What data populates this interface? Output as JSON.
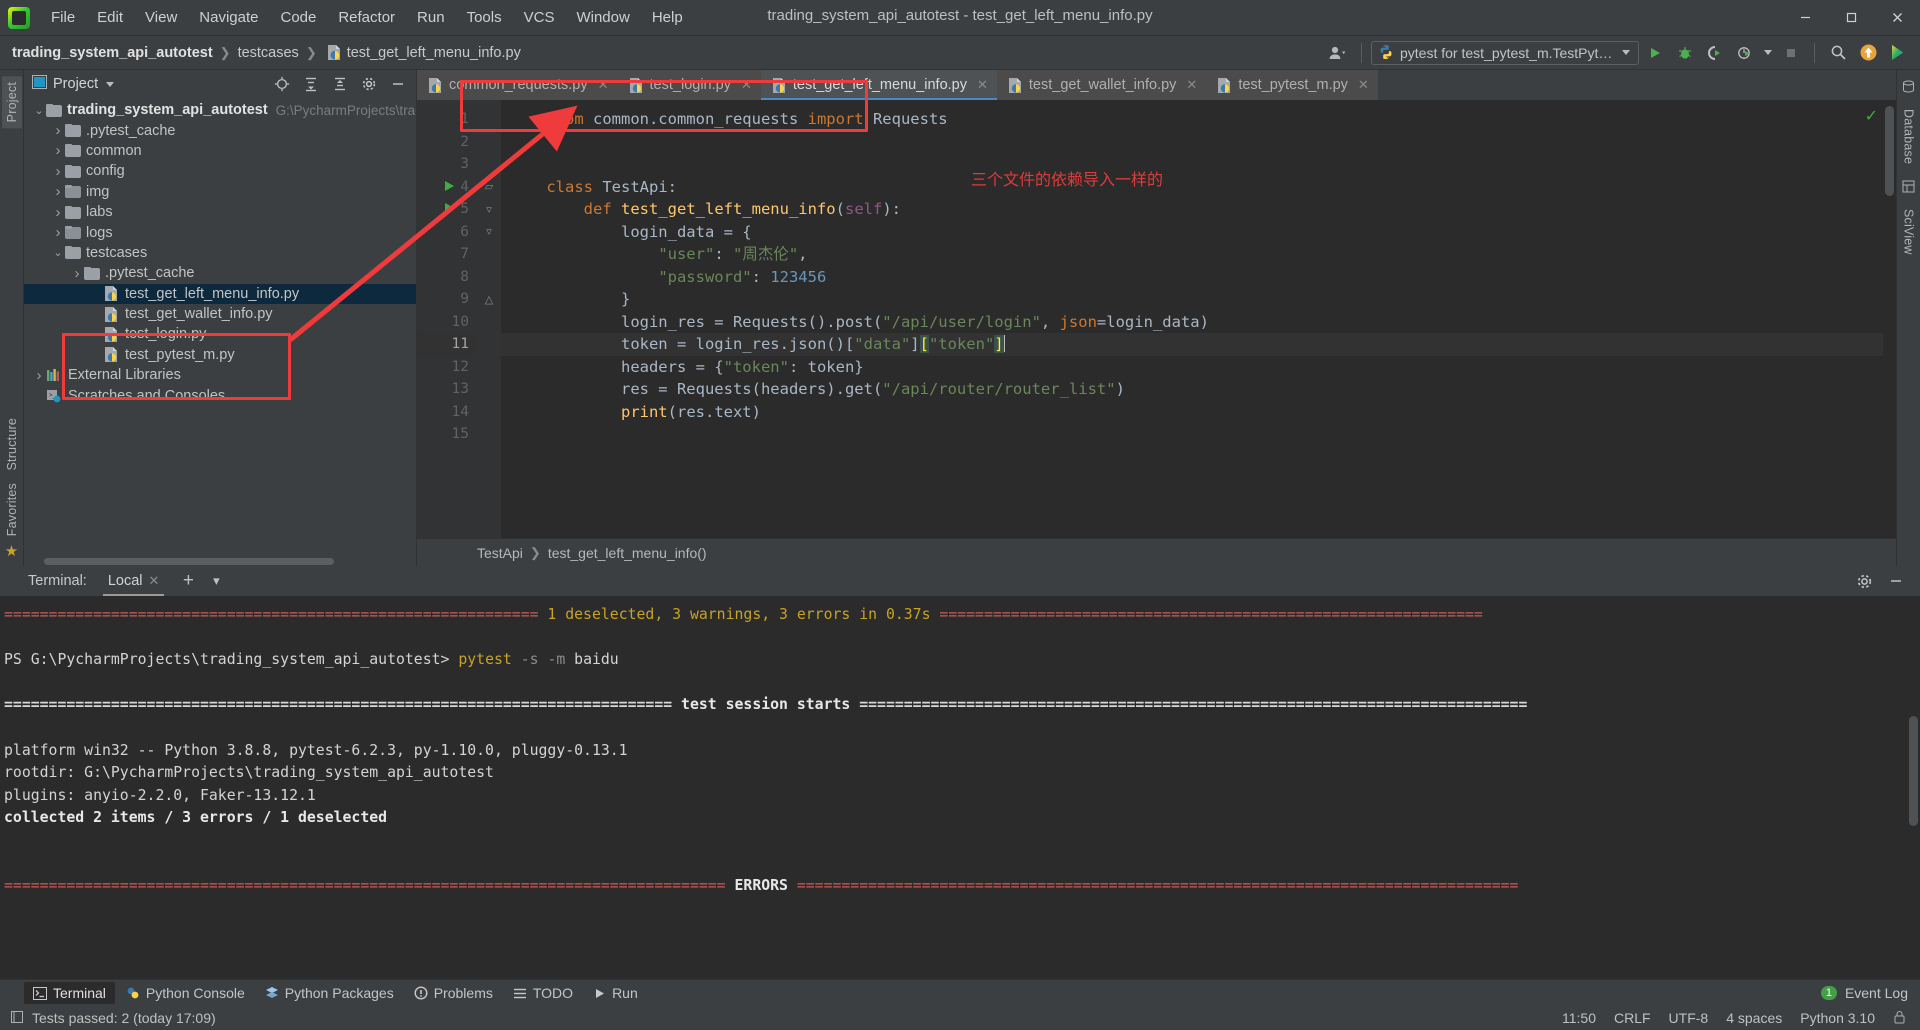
{
  "window": {
    "title": "trading_system_api_autotest - test_get_left_menu_info.py",
    "minimize": "—",
    "maximize": "▢",
    "close": "✕"
  },
  "menubar": [
    "File",
    "Edit",
    "View",
    "Navigate",
    "Code",
    "Refactor",
    "Run",
    "Tools",
    "VCS",
    "Window",
    "Help"
  ],
  "breadcrumb": {
    "project": "trading_system_api_autotest",
    "folder": "testcases",
    "file": "test_get_left_menu_info.py",
    "separator": "❯"
  },
  "toolbar": {
    "run_config": "pytest for test_pytest_m.TestPytest",
    "run_icon": "run-icon",
    "debug_icon": "debug-icon",
    "coverage_icon": "coverage-icon",
    "profile_icon": "profile-icon",
    "stop_icon": "stop-icon",
    "search_icon": "search-icon",
    "update_icon": "update-project-icon",
    "ide_icon": "ide-icon",
    "account_icon": "account-icon"
  },
  "left_strip": [
    "Project"
  ],
  "right_strip": [
    "Database",
    "SciView"
  ],
  "bottom_strip": [
    "Structure",
    "Favorites"
  ],
  "project_panel": {
    "title": "Project",
    "header_icons": [
      "target-icon",
      "expand-all-icon",
      "collapse-all-icon",
      "settings-icon",
      "hide-icon"
    ],
    "tree": [
      {
        "depth": 0,
        "arrow": "v",
        "icon": "folder",
        "label": "trading_system_api_autotest",
        "bold": true,
        "path": "G:\\PycharmProjects\\trading_",
        "selected": false
      },
      {
        "depth": 1,
        "arrow": ">",
        "icon": "folder",
        "label": ".pytest_cache",
        "bold": false,
        "path": "",
        "selected": false
      },
      {
        "depth": 1,
        "arrow": ">",
        "icon": "folder",
        "label": "common",
        "bold": false,
        "path": "",
        "selected": false
      },
      {
        "depth": 1,
        "arrow": ">",
        "icon": "folder",
        "label": "config",
        "bold": false,
        "path": "",
        "selected": false
      },
      {
        "depth": 1,
        "arrow": ">",
        "icon": "folder-dot",
        "label": "img",
        "bold": false,
        "path": "",
        "selected": false
      },
      {
        "depth": 1,
        "arrow": ">",
        "icon": "folder",
        "label": "labs",
        "bold": false,
        "path": "",
        "selected": false
      },
      {
        "depth": 1,
        "arrow": ">",
        "icon": "folder-dot",
        "label": "logs",
        "bold": false,
        "path": "",
        "selected": false
      },
      {
        "depth": 1,
        "arrow": "v",
        "icon": "folder",
        "label": "testcases",
        "bold": false,
        "path": "",
        "selected": false
      },
      {
        "depth": 2,
        "arrow": ">",
        "icon": "folder",
        "label": ".pytest_cache",
        "bold": false,
        "path": "",
        "selected": false
      },
      {
        "depth": 3,
        "arrow": "",
        "icon": "python",
        "label": "test_get_left_menu_info.py",
        "bold": false,
        "path": "",
        "selected": true
      },
      {
        "depth": 3,
        "arrow": "",
        "icon": "python",
        "label": "test_get_wallet_info.py",
        "bold": false,
        "path": "",
        "selected": false
      },
      {
        "depth": 3,
        "arrow": "",
        "icon": "python",
        "label": "test_login.py",
        "bold": false,
        "path": "",
        "selected": false
      },
      {
        "depth": 3,
        "arrow": "",
        "icon": "python",
        "label": "test_pytest_m.py",
        "bold": false,
        "path": "",
        "selected": false
      },
      {
        "depth": 0,
        "arrow": ">",
        "icon": "library",
        "label": "External Libraries",
        "bold": false,
        "path": "",
        "selected": false
      },
      {
        "depth": 0,
        "arrow": "",
        "icon": "scratches",
        "label": "Scratches and Consoles",
        "bold": false,
        "path": "",
        "selected": false
      }
    ]
  },
  "editor": {
    "tabs": [
      {
        "label": "common_requests.py",
        "active": false,
        "closable": true
      },
      {
        "label": "test_login.py",
        "active": false,
        "closable": true
      },
      {
        "label": "test_get_left_menu_info.py",
        "active": true,
        "closable": true
      },
      {
        "label": "test_get_wallet_info.py",
        "active": false,
        "closable": true
      },
      {
        "label": "test_pytest_m.py",
        "active": false,
        "closable": true
      }
    ],
    "line_numbers": [
      "1",
      "2",
      "3",
      "4",
      "5",
      "6",
      "7",
      "8",
      "9",
      "10",
      "11",
      "12",
      "13",
      "14",
      "15"
    ],
    "current_line": 11,
    "run_markers": [
      4,
      5
    ],
    "lines": [
      {
        "n": 1,
        "tokens": [
          {
            "t": "    ",
            "c": "plain"
          },
          {
            "t": "from",
            "c": "kw"
          },
          {
            "t": " common.common_requests ",
            "c": "plain"
          },
          {
            "t": "import",
            "c": "kw"
          },
          {
            "t": " Requests",
            "c": "plain"
          }
        ]
      },
      {
        "n": 2,
        "tokens": []
      },
      {
        "n": 3,
        "tokens": []
      },
      {
        "n": 4,
        "tokens": [
          {
            "t": "    ",
            "c": "plain"
          },
          {
            "t": "class",
            "c": "kw"
          },
          {
            "t": " TestApi",
            "c": "cls"
          },
          {
            "t": ":",
            "c": "plain"
          }
        ]
      },
      {
        "n": 5,
        "tokens": [
          {
            "t": "        ",
            "c": "plain"
          },
          {
            "t": "def",
            "c": "kw"
          },
          {
            "t": " ",
            "c": "plain"
          },
          {
            "t": "test_get_left_menu_info",
            "c": "fn"
          },
          {
            "t": "(",
            "c": "plain"
          },
          {
            "t": "self",
            "c": "self"
          },
          {
            "t": "):",
            "c": "plain"
          }
        ]
      },
      {
        "n": 6,
        "tokens": [
          {
            "t": "            login_data = {",
            "c": "plain"
          }
        ]
      },
      {
        "n": 7,
        "tokens": [
          {
            "t": "                ",
            "c": "plain"
          },
          {
            "t": "\"user\"",
            "c": "str"
          },
          {
            "t": ": ",
            "c": "plain"
          },
          {
            "t": "\"周杰伦\"",
            "c": "str"
          },
          {
            "t": ",",
            "c": "plain"
          }
        ]
      },
      {
        "n": 8,
        "tokens": [
          {
            "t": "                ",
            "c": "plain"
          },
          {
            "t": "\"password\"",
            "c": "str"
          },
          {
            "t": ": ",
            "c": "plain"
          },
          {
            "t": "123456",
            "c": "num"
          }
        ]
      },
      {
        "n": 9,
        "tokens": [
          {
            "t": "            }",
            "c": "plain"
          }
        ]
      },
      {
        "n": 10,
        "tokens": [
          {
            "t": "            login_res = Requests().post(",
            "c": "plain"
          },
          {
            "t": "\"/api/user/login\"",
            "c": "str"
          },
          {
            "t": ", ",
            "c": "plain"
          },
          {
            "t": "json",
            "c": "param"
          },
          {
            "t": "=login_data)",
            "c": "plain"
          }
        ]
      },
      {
        "n": 11,
        "tokens": [
          {
            "t": "            token = login_res.json()[",
            "c": "plain"
          },
          {
            "t": "\"data\"",
            "c": "str"
          },
          {
            "t": "]",
            "c": "plain"
          },
          {
            "t": "[",
            "c": "brhl"
          },
          {
            "t": "\"token\"",
            "c": "str"
          },
          {
            "t": "]",
            "c": "brhl"
          }
        ]
      },
      {
        "n": 12,
        "tokens": [
          {
            "t": "            headers = {",
            "c": "plain"
          },
          {
            "t": "\"token\"",
            "c": "str"
          },
          {
            "t": ": token}",
            "c": "plain"
          }
        ]
      },
      {
        "n": 13,
        "tokens": [
          {
            "t": "            res = Requests(headers).get(",
            "c": "plain"
          },
          {
            "t": "\"/api/router/router_list\"",
            "c": "str"
          },
          {
            "t": ")",
            "c": "plain"
          }
        ]
      },
      {
        "n": 14,
        "tokens": [
          {
            "t": "            ",
            "c": "plain"
          },
          {
            "t": "print",
            "c": "fn"
          },
          {
            "t": "(res.text)",
            "c": "plain"
          }
        ]
      },
      {
        "n": 15,
        "tokens": []
      }
    ],
    "annotation_cn": "三个文件的依赖导入一样的",
    "breadcrumb_bottom": {
      "class": "TestApi",
      "method": "test_get_left_menu_info()",
      "separator": "❯"
    },
    "inspection_status": "✓"
  },
  "terminal": {
    "label": "Terminal:",
    "tab": "Local",
    "add_icon": "+",
    "dropdown_icon": "▾",
    "settings_icon": "gear-icon",
    "hide_icon": "—",
    "output": [
      {
        "segments": [
          {
            "t": "============================================================ ",
            "c": "t-red"
          },
          {
            "t": "1 deselected, 3 warnings, 3 errors in 0.37s",
            "c": "t-yellow"
          },
          {
            "t": " =============================================================",
            "c": "t-red"
          }
        ]
      },
      {
        "segments": []
      },
      {
        "segments": [
          {
            "t": "PS G:\\PycharmProjects\\trading_system_api_autotest> ",
            "c": "t-white"
          },
          {
            "t": "pytest",
            "c": "t-yellow"
          },
          {
            "t": " -s",
            "c": "t-grey"
          },
          {
            "t": " -m",
            "c": "t-grey"
          },
          {
            "t": " baidu",
            "c": "t-white"
          }
        ]
      },
      {
        "segments": []
      },
      {
        "segments": [
          {
            "t": "=========================================================================== ",
            "c": "t-sep-white"
          },
          {
            "t": "test session starts",
            "c": "t-bold-white"
          },
          {
            "t": " ===========================================================================",
            "c": "t-sep-white"
          }
        ]
      },
      {
        "segments": []
      },
      {
        "segments": [
          {
            "t": "platform win32 -- Python 3.8.8, pytest-6.2.3, py-1.10.0, pluggy-0.13.1",
            "c": "t-white"
          }
        ]
      },
      {
        "segments": [
          {
            "t": "rootdir: G:\\PycharmProjects\\trading_system_api_autotest",
            "c": "t-white"
          }
        ]
      },
      {
        "segments": [
          {
            "t": "plugins: anyio-2.2.0, Faker-13.12.1",
            "c": "t-white"
          }
        ]
      },
      {
        "segments": [
          {
            "t": "collected 2 items / 3 errors / 1 deselected",
            "c": "t-bold-white"
          }
        ]
      },
      {
        "segments": []
      },
      {
        "segments": []
      },
      {
        "segments": [
          {
            "t": "================================================================================= ",
            "c": "t-red"
          },
          {
            "t": "ERRORS",
            "c": "t-bold-white"
          },
          {
            "t": " =================================================================================",
            "c": "t-red"
          }
        ]
      },
      {
        "segments": []
      }
    ]
  },
  "bottom_toolbar": [
    {
      "label": "Run",
      "icon": "run-icon",
      "active": false
    },
    {
      "label": "TODO",
      "icon": "todo-icon",
      "active": false
    },
    {
      "label": "Problems",
      "icon": "problems-icon",
      "active": false
    },
    {
      "label": "Python Packages",
      "icon": "packages-icon",
      "active": false
    },
    {
      "label": "Python Console",
      "icon": "python-console-icon",
      "active": false
    },
    {
      "label": "Terminal",
      "icon": "terminal-icon",
      "active": true
    }
  ],
  "event_log": {
    "count": "1",
    "label": "Event Log"
  },
  "statusbar": {
    "message": "Tests passed: 2 (today 17:09)",
    "time": "11:50",
    "line_sep": "CRLF",
    "encoding": "UTF-8",
    "indent": "4 spaces",
    "interpreter": "Python 3.10",
    "lock_icon": "lock-icon"
  },
  "colors": {
    "accent_blue": "#4a88c7",
    "annotation_red": "#ef3b3b",
    "selection": "#0d293e",
    "editor_bg": "#2b2b2b",
    "panel_bg": "#3c3f41",
    "terminal_green": "#3fae3f"
  }
}
